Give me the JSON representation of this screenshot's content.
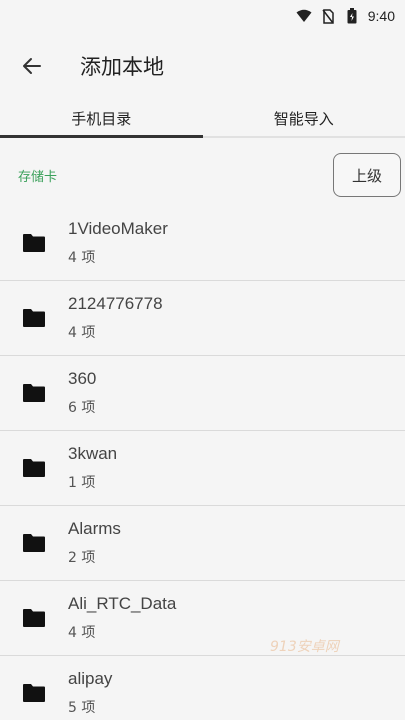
{
  "status_bar": {
    "time": "9:40"
  },
  "app_bar": {
    "title": "添加本地"
  },
  "tabs": [
    {
      "label": "手机目录",
      "active": true
    },
    {
      "label": "智能导入",
      "active": false
    }
  ],
  "path": {
    "label": "存储卡",
    "up_button": "上级"
  },
  "folders": [
    {
      "name": "1VideoMaker",
      "count": "4 项"
    },
    {
      "name": "2124776778",
      "count": "4 项"
    },
    {
      "name": "360",
      "count": "6 项"
    },
    {
      "name": "3kwan",
      "count": "1 项"
    },
    {
      "name": "Alarms",
      "count": "2 项"
    },
    {
      "name": "Ali_RTC_Data",
      "count": "4 项"
    },
    {
      "name": "alipay",
      "count": "5 项"
    }
  ],
  "watermark": "913安卓网",
  "colors": {
    "accent_green": "#3aa05a",
    "tab_indicator": "#333333"
  }
}
